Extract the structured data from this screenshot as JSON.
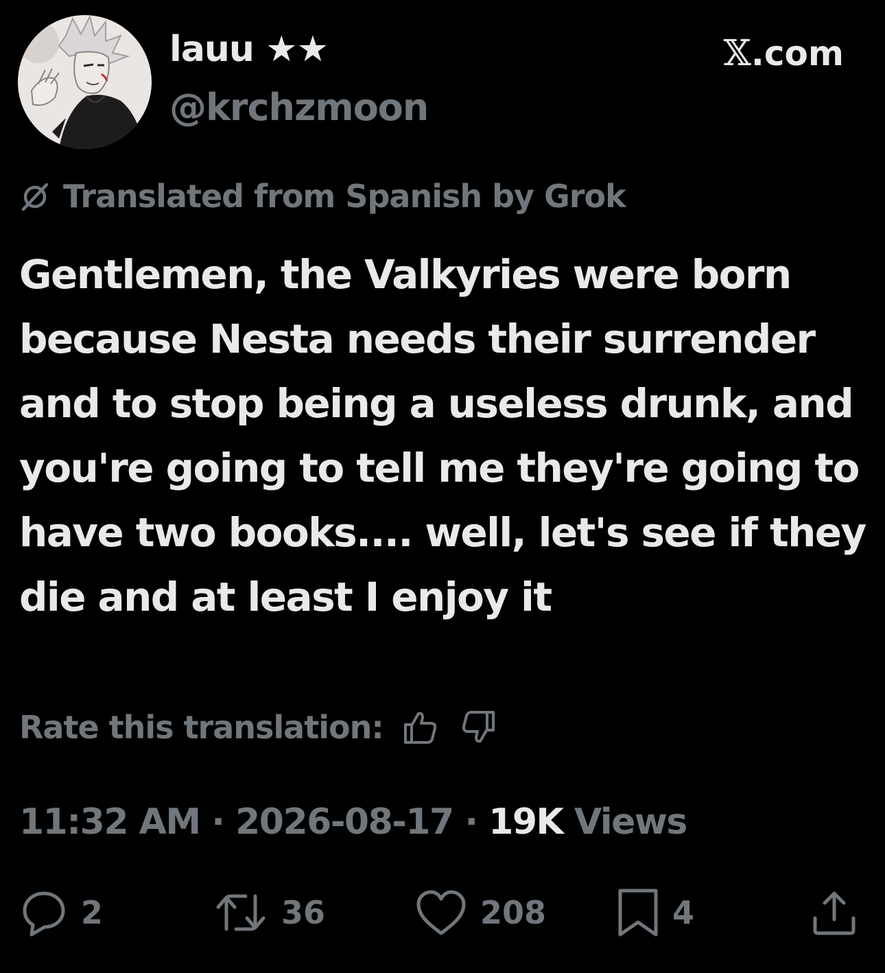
{
  "header": {
    "display_name": "lauu ★★",
    "handle": "@krchzmoon",
    "site_x": "𝕏",
    "site_suffix": ".com",
    "avatar_icon": "avatar-illustration"
  },
  "translation": {
    "note": "Translated from Spanish by Grok",
    "icon": "grok-icon",
    "rate_label": "Rate this translation:"
  },
  "tweet": {
    "text": "Gentlemen, the Valkyries were born because Nesta needs their surrender and to stop being a useless drunk, and you're going to tell me they're going to have two books.... well, let's see if they die and at least I enjoy it"
  },
  "meta": {
    "time": "11:32 AM",
    "sep1": " · ",
    "date": "2026-08-17",
    "sep2": " · ",
    "views_count": "19K",
    "views_label": " Views"
  },
  "actions": {
    "replies": "2",
    "reposts": "36",
    "likes": "208",
    "bookmarks": "4"
  },
  "colors": {
    "background": "#000000",
    "primary_text": "#e7e9ea",
    "secondary_text": "#71767b"
  }
}
